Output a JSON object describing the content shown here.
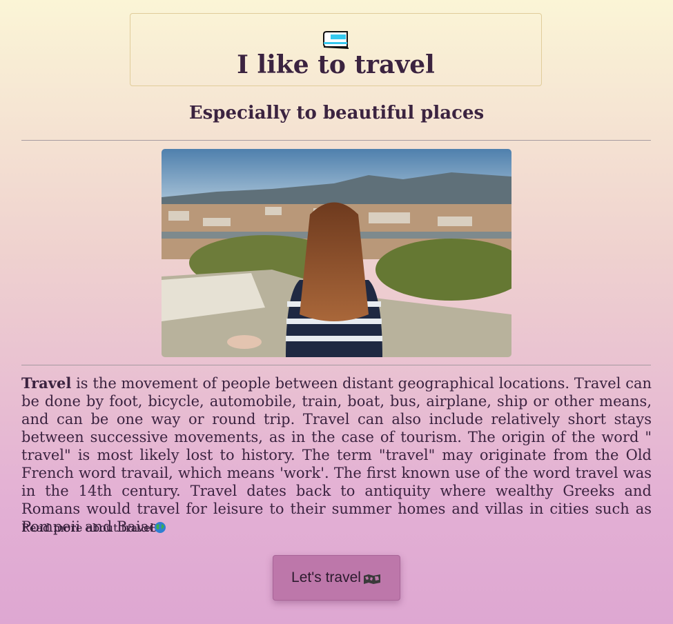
{
  "header": {
    "icon": "train-icon",
    "title": "I like to travel"
  },
  "subtitle": "Especially to beautiful places",
  "photo": {
    "icon": "photo-girl-overlooking-city"
  },
  "article": {
    "lead_word": "Travel",
    "body": " is the movement of people between distant geographical locations. Travel can be done by foot, bicycle, automobile, train, boat, bus, airplane, ship or other means, and can be one way or round trip. Travel can also include relatively short stays between successive movements, as in the case of tourism. The origin of the word \" travel\" is most likely lost to history. The term \"travel\" may originate from the Old French word travail, which means 'work'. The first known use of the word travel was in the 14th century. Travel dates back to antiquity where wealthy Greeks and Romans would travel for leisure to their summer homes and villas in cities such as Pompeii and Baiae."
  },
  "read_more": {
    "label": "Read more about travel",
    "icon": "globe-icon"
  },
  "cta": {
    "label": "Let's travel",
    "icon": "world-map-icon"
  },
  "colors": {
    "text": "#3b2340",
    "button": "#bd77aa",
    "background_top": "#fbf5d6",
    "background_bottom": "#dea7d2"
  }
}
